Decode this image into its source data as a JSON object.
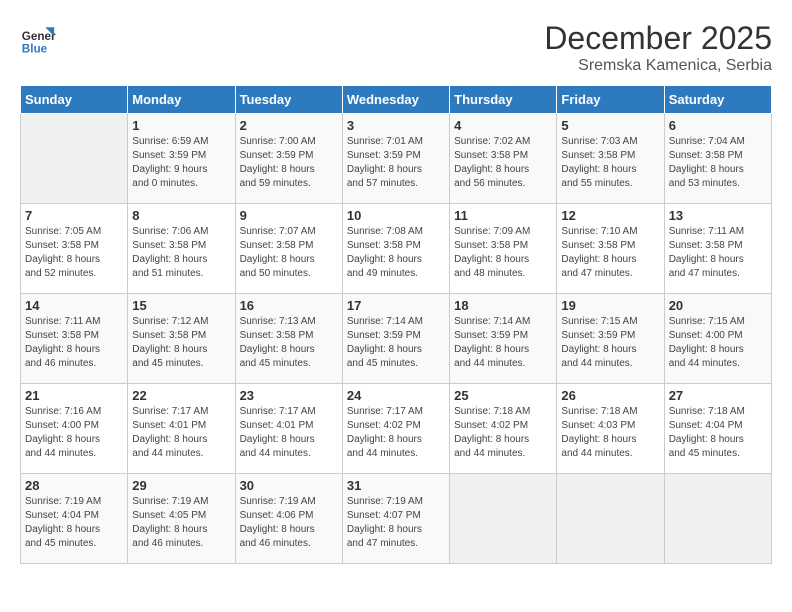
{
  "logo": {
    "line1": "General",
    "line2": "Blue"
  },
  "title": "December 2025",
  "subtitle": "Sremska Kamenica, Serbia",
  "days_of_week": [
    "Sunday",
    "Monday",
    "Tuesday",
    "Wednesday",
    "Thursday",
    "Friday",
    "Saturday"
  ],
  "weeks": [
    [
      {
        "day": "",
        "info": ""
      },
      {
        "day": "1",
        "info": "Sunrise: 6:59 AM\nSunset: 3:59 PM\nDaylight: 9 hours\nand 0 minutes."
      },
      {
        "day": "2",
        "info": "Sunrise: 7:00 AM\nSunset: 3:59 PM\nDaylight: 8 hours\nand 59 minutes."
      },
      {
        "day": "3",
        "info": "Sunrise: 7:01 AM\nSunset: 3:59 PM\nDaylight: 8 hours\nand 57 minutes."
      },
      {
        "day": "4",
        "info": "Sunrise: 7:02 AM\nSunset: 3:58 PM\nDaylight: 8 hours\nand 56 minutes."
      },
      {
        "day": "5",
        "info": "Sunrise: 7:03 AM\nSunset: 3:58 PM\nDaylight: 8 hours\nand 55 minutes."
      },
      {
        "day": "6",
        "info": "Sunrise: 7:04 AM\nSunset: 3:58 PM\nDaylight: 8 hours\nand 53 minutes."
      }
    ],
    [
      {
        "day": "7",
        "info": "Sunrise: 7:05 AM\nSunset: 3:58 PM\nDaylight: 8 hours\nand 52 minutes."
      },
      {
        "day": "8",
        "info": "Sunrise: 7:06 AM\nSunset: 3:58 PM\nDaylight: 8 hours\nand 51 minutes."
      },
      {
        "day": "9",
        "info": "Sunrise: 7:07 AM\nSunset: 3:58 PM\nDaylight: 8 hours\nand 50 minutes."
      },
      {
        "day": "10",
        "info": "Sunrise: 7:08 AM\nSunset: 3:58 PM\nDaylight: 8 hours\nand 49 minutes."
      },
      {
        "day": "11",
        "info": "Sunrise: 7:09 AM\nSunset: 3:58 PM\nDaylight: 8 hours\nand 48 minutes."
      },
      {
        "day": "12",
        "info": "Sunrise: 7:10 AM\nSunset: 3:58 PM\nDaylight: 8 hours\nand 47 minutes."
      },
      {
        "day": "13",
        "info": "Sunrise: 7:11 AM\nSunset: 3:58 PM\nDaylight: 8 hours\nand 47 minutes."
      }
    ],
    [
      {
        "day": "14",
        "info": "Sunrise: 7:11 AM\nSunset: 3:58 PM\nDaylight: 8 hours\nand 46 minutes."
      },
      {
        "day": "15",
        "info": "Sunrise: 7:12 AM\nSunset: 3:58 PM\nDaylight: 8 hours\nand 45 minutes."
      },
      {
        "day": "16",
        "info": "Sunrise: 7:13 AM\nSunset: 3:58 PM\nDaylight: 8 hours\nand 45 minutes."
      },
      {
        "day": "17",
        "info": "Sunrise: 7:14 AM\nSunset: 3:59 PM\nDaylight: 8 hours\nand 45 minutes."
      },
      {
        "day": "18",
        "info": "Sunrise: 7:14 AM\nSunset: 3:59 PM\nDaylight: 8 hours\nand 44 minutes."
      },
      {
        "day": "19",
        "info": "Sunrise: 7:15 AM\nSunset: 3:59 PM\nDaylight: 8 hours\nand 44 minutes."
      },
      {
        "day": "20",
        "info": "Sunrise: 7:15 AM\nSunset: 4:00 PM\nDaylight: 8 hours\nand 44 minutes."
      }
    ],
    [
      {
        "day": "21",
        "info": "Sunrise: 7:16 AM\nSunset: 4:00 PM\nDaylight: 8 hours\nand 44 minutes."
      },
      {
        "day": "22",
        "info": "Sunrise: 7:17 AM\nSunset: 4:01 PM\nDaylight: 8 hours\nand 44 minutes."
      },
      {
        "day": "23",
        "info": "Sunrise: 7:17 AM\nSunset: 4:01 PM\nDaylight: 8 hours\nand 44 minutes."
      },
      {
        "day": "24",
        "info": "Sunrise: 7:17 AM\nSunset: 4:02 PM\nDaylight: 8 hours\nand 44 minutes."
      },
      {
        "day": "25",
        "info": "Sunrise: 7:18 AM\nSunset: 4:02 PM\nDaylight: 8 hours\nand 44 minutes."
      },
      {
        "day": "26",
        "info": "Sunrise: 7:18 AM\nSunset: 4:03 PM\nDaylight: 8 hours\nand 44 minutes."
      },
      {
        "day": "27",
        "info": "Sunrise: 7:18 AM\nSunset: 4:04 PM\nDaylight: 8 hours\nand 45 minutes."
      }
    ],
    [
      {
        "day": "28",
        "info": "Sunrise: 7:19 AM\nSunset: 4:04 PM\nDaylight: 8 hours\nand 45 minutes."
      },
      {
        "day": "29",
        "info": "Sunrise: 7:19 AM\nSunset: 4:05 PM\nDaylight: 8 hours\nand 46 minutes."
      },
      {
        "day": "30",
        "info": "Sunrise: 7:19 AM\nSunset: 4:06 PM\nDaylight: 8 hours\nand 46 minutes."
      },
      {
        "day": "31",
        "info": "Sunrise: 7:19 AM\nSunset: 4:07 PM\nDaylight: 8 hours\nand 47 minutes."
      },
      {
        "day": "",
        "info": ""
      },
      {
        "day": "",
        "info": ""
      },
      {
        "day": "",
        "info": ""
      }
    ]
  ]
}
